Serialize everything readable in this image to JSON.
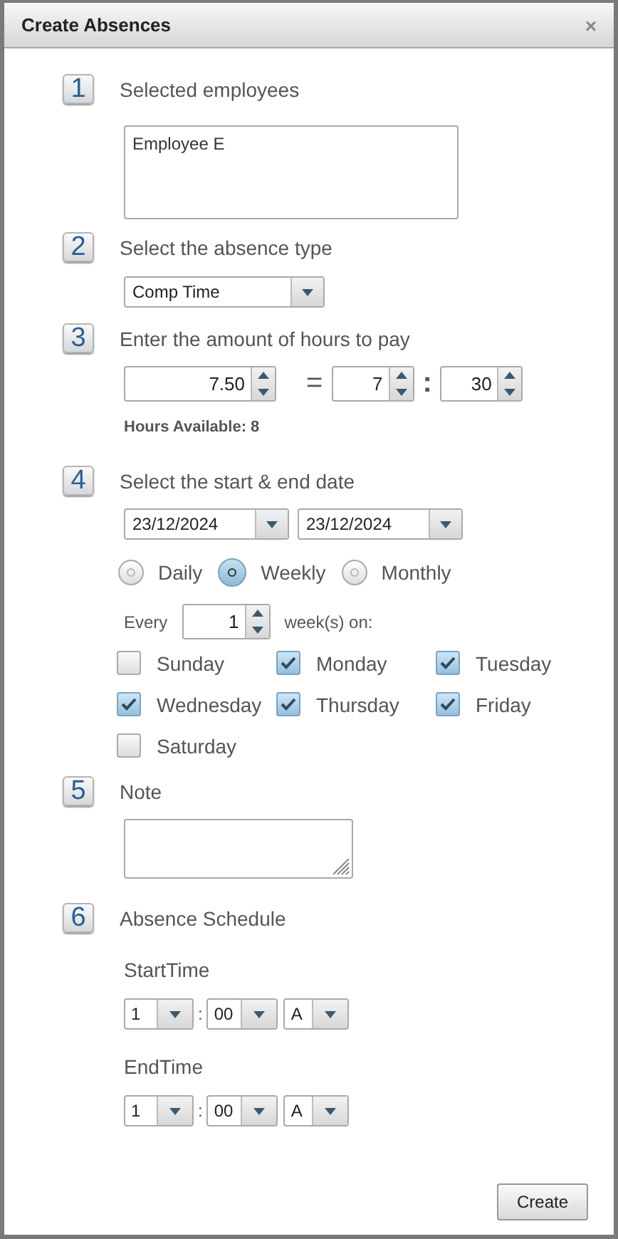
{
  "window": {
    "title": "Create Absences",
    "close": "×"
  },
  "employees": {
    "number": "1",
    "label": "Selected employees",
    "value": "Employee E"
  },
  "absence_type": {
    "number": "2",
    "label": "Select the absence type",
    "value": "Comp Time"
  },
  "hours": {
    "number": "3",
    "label": "Enter the amount of hours to pay",
    "amount": "7.50",
    "equals": "=",
    "hours": "7",
    "separator": ":",
    "minutes": "30",
    "available": "Hours Available: 8"
  },
  "dates": {
    "number": "4",
    "label": "Select the start & end date",
    "start": "23/12/2024",
    "end": "23/12/2024",
    "recurrence": [
      {
        "label": "Daily",
        "selected": false
      },
      {
        "label": "Weekly",
        "selected": true
      },
      {
        "label": "Monthly",
        "selected": false
      }
    ],
    "every_label": "Every",
    "every_value": "1",
    "every_unit": "week(s) on:",
    "days": [
      {
        "label": "Sunday",
        "checked": false
      },
      {
        "label": "Monday",
        "checked": true
      },
      {
        "label": "Tuesday",
        "checked": true
      },
      {
        "label": "Wednesday",
        "checked": true
      },
      {
        "label": "Thursday",
        "checked": true
      },
      {
        "label": "Friday",
        "checked": true
      },
      {
        "label": "Saturday",
        "checked": false
      }
    ]
  },
  "note": {
    "number": "5",
    "label": "Note"
  },
  "schedule": {
    "number": "6",
    "label": "Absence Schedule",
    "times": [
      {
        "label": "StartTime",
        "hour": "1",
        "separator": ":",
        "minute": "00",
        "period": "A"
      },
      {
        "label": "EndTime",
        "hour": "1",
        "separator": ":",
        "minute": "00",
        "period": "A"
      }
    ]
  },
  "buttons": [
    {
      "label": "Create"
    }
  ]
}
